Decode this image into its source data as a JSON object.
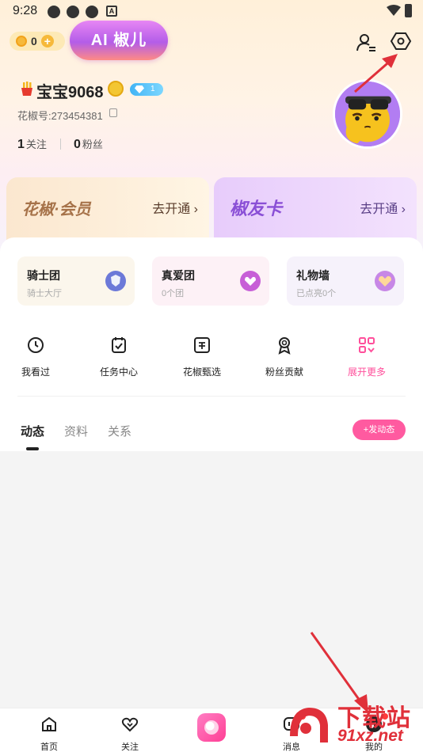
{
  "status_bar": {
    "time": "9:28",
    "notif_letter": "A"
  },
  "header": {
    "coin_count": "0",
    "coin_plus": "+",
    "ai_button": "AI 椒儿"
  },
  "profile": {
    "nickname": "宝宝9068",
    "level": "1",
    "user_id": "花椒号:273454381",
    "following_count": "1",
    "following_label": "关注",
    "fans_count": "0",
    "fans_label": "粉丝"
  },
  "membership": [
    {
      "title": "花椒·会员",
      "cta": "去开通 ›"
    },
    {
      "title": "椒友卡",
      "cta": "去开通 ›"
    }
  ],
  "clubs": [
    {
      "title": "骑士团",
      "subtitle": "骑士大厅",
      "bg": "#fbf6ec",
      "icon_bg": "#6c79d8"
    },
    {
      "title": "真爱团",
      "subtitle": "0个团",
      "bg": "#fdf1f6",
      "icon_bg": "#c75fd7"
    },
    {
      "title": "礼物墙",
      "subtitle": "已点亮0个",
      "bg": "#f6f2fb",
      "icon_bg": "#c787e6"
    }
  ],
  "tools": [
    {
      "label": "我看过",
      "icon": "clock-icon"
    },
    {
      "label": "任务中心",
      "icon": "task-check-icon"
    },
    {
      "label": "花椒甄选",
      "icon": "selection-icon"
    },
    {
      "label": "粉丝贡献",
      "icon": "ribbon-medal-icon"
    },
    {
      "label": "展开更多",
      "icon": "grid-more-icon"
    }
  ],
  "content_tabs": [
    "动态",
    "资料",
    "关系"
  ],
  "post_button": "+发动态",
  "bottom_nav": [
    {
      "label": "首页",
      "icon": "home-icon"
    },
    {
      "label": "关注",
      "icon": "heart-icon"
    },
    {
      "label": "",
      "icon": "live-camera-icon"
    },
    {
      "label": "消息",
      "icon": "message-icon"
    },
    {
      "label": "我的",
      "icon": "profile-icon"
    }
  ],
  "watermark": {
    "line1": "下载站",
    "line2": "91xz.net"
  },
  "colors": {
    "accent_pink": "#ff5aa0",
    "ai_purple": "#b35de8",
    "annotation_red": "#e0303a"
  }
}
